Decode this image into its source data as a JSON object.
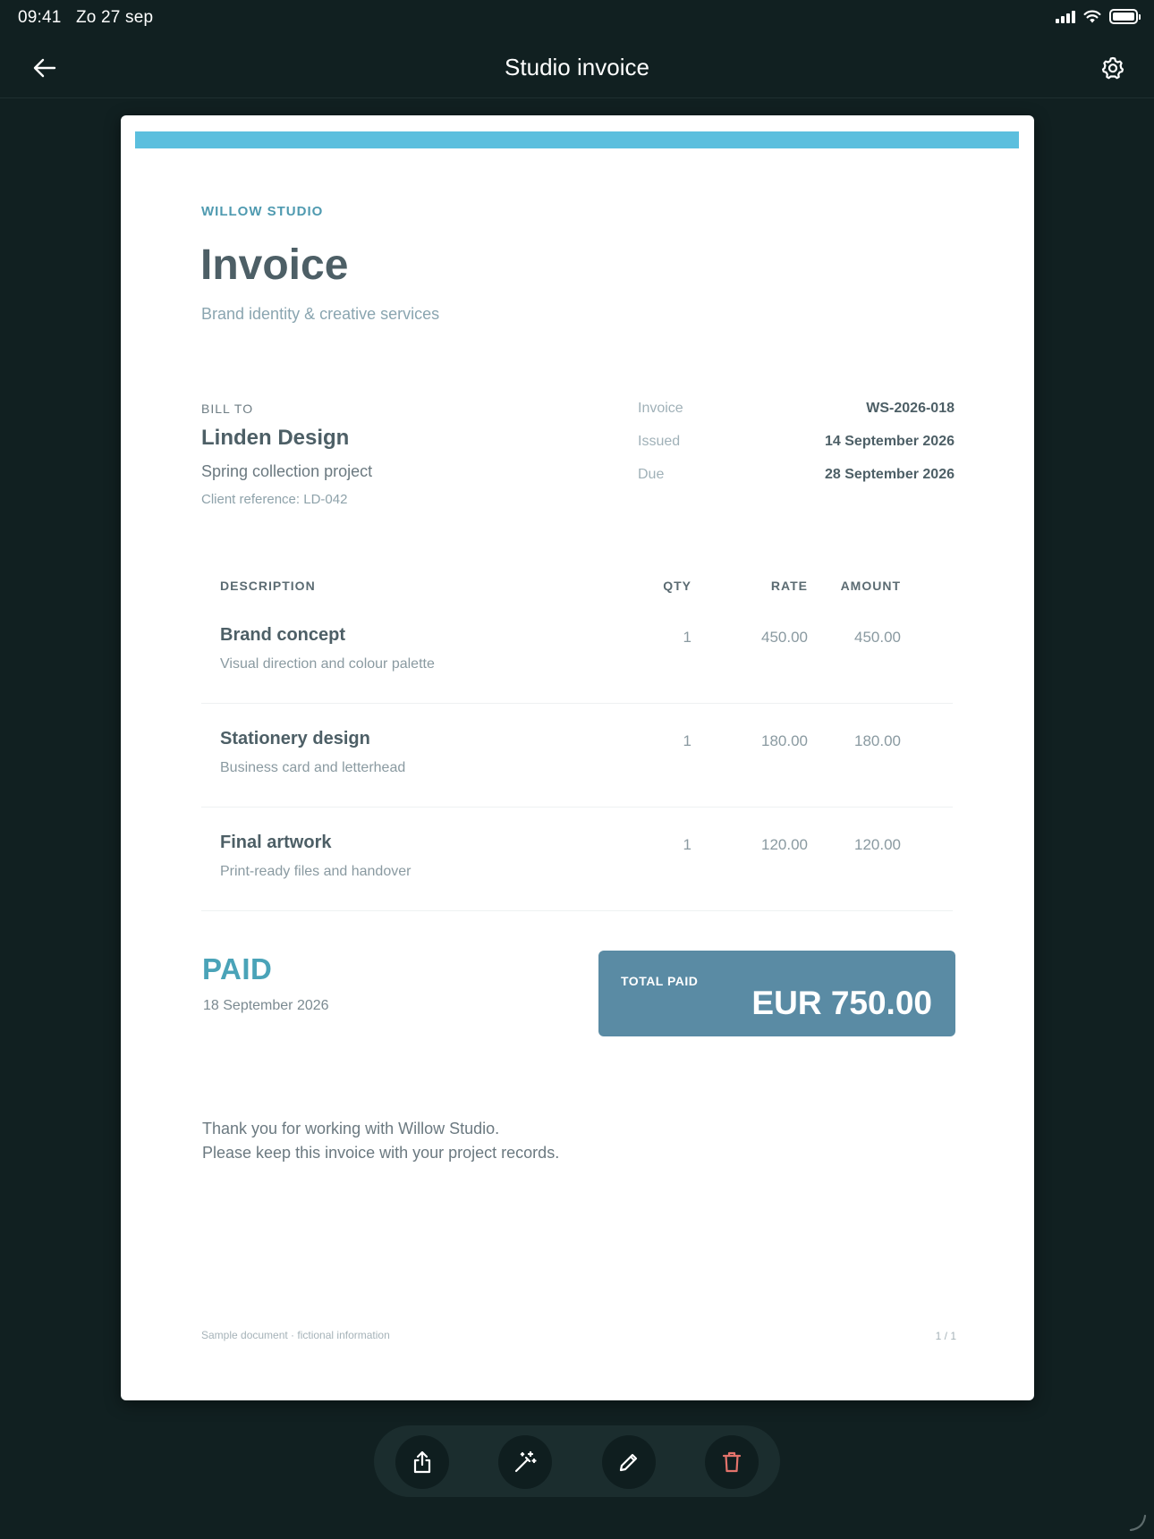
{
  "status_bar": {
    "time_date": "09:41   Zo 27 sep"
  },
  "nav": {
    "title": "Studio invoice"
  },
  "document": {
    "brand": "WILLOW STUDIO",
    "title": "Invoice",
    "subtitle": "Brand identity & creative services",
    "bill_to": {
      "label": "BILL TO",
      "name": "Linden Design",
      "project": "Spring collection project",
      "reference": "Client reference: LD-042"
    },
    "meta": [
      {
        "label": "Invoice",
        "value": "WS-2026-018"
      },
      {
        "label": "Issued",
        "value": "14 September 2026"
      },
      {
        "label": "Due",
        "value": "28 September 2026"
      }
    ],
    "table": {
      "headers": {
        "description": "DESCRIPTION",
        "qty": "QTY",
        "rate": "RATE",
        "amount": "AMOUNT"
      },
      "rows": [
        {
          "title": "Brand concept",
          "subtitle": "Visual direction and colour palette",
          "qty": "1",
          "rate": "450.00",
          "amount": "450.00"
        },
        {
          "title": "Stationery design",
          "subtitle": "Business card and letterhead",
          "qty": "1",
          "rate": "180.00",
          "amount": "180.00"
        },
        {
          "title": "Final artwork",
          "subtitle": "Print-ready files and handover",
          "qty": "1",
          "rate": "120.00",
          "amount": "120.00"
        }
      ]
    },
    "paid": {
      "label": "PAID",
      "date": "18 September 2026"
    },
    "total": {
      "label": "TOTAL PAID",
      "amount": "EUR 750.00"
    },
    "thanks": {
      "line1": "Thank you for working with Willow Studio.",
      "line2": "Please keep this invoice with your project records."
    },
    "footer_note": "Sample document · fictional information",
    "page_number": "1 / 1"
  },
  "toolbar": {
    "icons": [
      "share-icon",
      "magic-wand-icon",
      "pencil-icon",
      "trash-icon"
    ]
  },
  "colors": {
    "background": "#112021",
    "accent_stripe": "#5bbfde",
    "total_box": "#5a8ba4",
    "paid": "#4aa3b8",
    "delete": "#e3736b"
  }
}
